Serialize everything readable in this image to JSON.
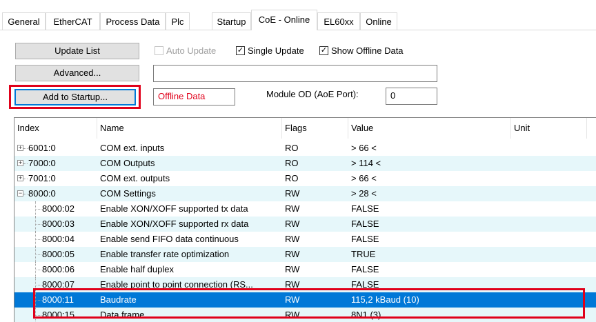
{
  "tabs": [
    "General",
    "EtherCAT",
    "Process Data",
    "Plc",
    "Startup",
    "CoE - Online",
    "EL60xx",
    "Online"
  ],
  "active_tab": "CoE - Online",
  "buttons": {
    "update_list": "Update List",
    "advanced": "Advanced...",
    "add_to_startup": "Add to Startup..."
  },
  "checkboxes": {
    "auto_update": {
      "label": "Auto Update",
      "checked": false,
      "disabled": true
    },
    "single_update": {
      "label": "Single Update",
      "checked": true
    },
    "show_offline": {
      "label": "Show Offline Data",
      "checked": true
    }
  },
  "filter_value": "",
  "offline_data_label": "Offline Data",
  "module_od_label": "Module OD (AoE Port):",
  "module_od_value": "0",
  "columns": [
    "Index",
    "Name",
    "Flags",
    "Value",
    "Unit"
  ],
  "rows": [
    {
      "index": "6001:0",
      "name": "COM ext. inputs",
      "flags": "RO",
      "value": "> 66 <",
      "expander": "+",
      "level": 0
    },
    {
      "index": "7000:0",
      "name": "COM Outputs",
      "flags": "RO",
      "value": "> 114 <",
      "expander": "+",
      "level": 0
    },
    {
      "index": "7001:0",
      "name": "COM ext. outputs",
      "flags": "RO",
      "value": "> 66 <",
      "expander": "+",
      "level": 0
    },
    {
      "index": "8000:0",
      "name": "COM Settings",
      "flags": "RW",
      "value": "> 28 <",
      "expander": "−",
      "level": 0
    },
    {
      "index": "8000:02",
      "name": "Enable XON/XOFF supported tx data",
      "flags": "RW",
      "value": "FALSE",
      "expander": "",
      "level": 1
    },
    {
      "index": "8000:03",
      "name": "Enable XON/XOFF supported rx data",
      "flags": "RW",
      "value": "FALSE",
      "expander": "",
      "level": 1
    },
    {
      "index": "8000:04",
      "name": "Enable send FIFO data continuous",
      "flags": "RW",
      "value": "FALSE",
      "expander": "",
      "level": 1
    },
    {
      "index": "8000:05",
      "name": "Enable transfer rate optimization",
      "flags": "RW",
      "value": "TRUE",
      "expander": "",
      "level": 1
    },
    {
      "index": "8000:06",
      "name": "Enable half duplex",
      "flags": "RW",
      "value": "FALSE",
      "expander": "",
      "level": 1
    },
    {
      "index": "8000:07",
      "name": "Enable point to point connection (RS...",
      "flags": "RW",
      "value": "FALSE",
      "expander": "",
      "level": 1
    },
    {
      "index": "8000:11",
      "name": "Baudrate",
      "flags": "RW",
      "value": "115,2 kBaud (10)",
      "expander": "",
      "level": 1,
      "selected": true
    },
    {
      "index": "8000:15",
      "name": "Data frame",
      "flags": "RW",
      "value": "8N1 (3)",
      "expander": "",
      "level": 1
    }
  ],
  "colors": {
    "highlight_red": "#e0001a",
    "selection_blue": "#0078d7",
    "alt_row": "#e6f7fa"
  }
}
